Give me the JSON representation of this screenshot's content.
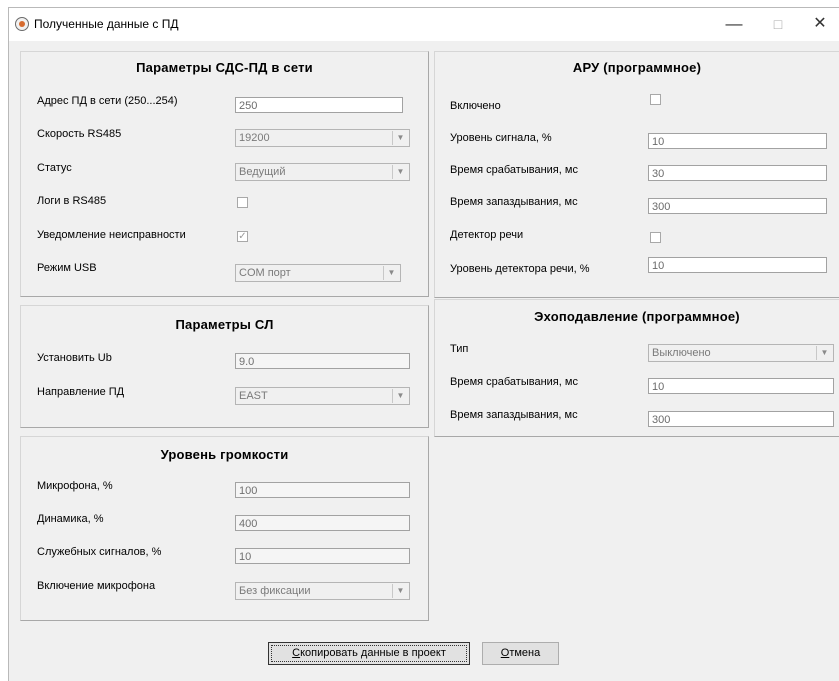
{
  "window": {
    "title": "Полученные данные с ПД",
    "minimize": "—",
    "maximize": "□",
    "close": "✕"
  },
  "network_group": {
    "title": "Параметры СДС-ПД в сети",
    "address_label": "Адрес  ПД в сети (250...254)",
    "address_value": "250",
    "speed_label": "Скорость RS485",
    "speed_value": "19200",
    "status_label": "Статус",
    "status_value": "Ведущий",
    "logs_label": "Логи в RS485",
    "logs_checked": false,
    "fault_label": "Уведомление неисправности",
    "fault_checked": true,
    "usb_label": "Режим USB",
    "usb_value": "COM порт"
  },
  "line_group": {
    "title": "Параметры СЛ",
    "ub_label": "Установить Ub",
    "ub_value": "9.0",
    "direction_label": "Направление ПД",
    "direction_value": "EAST"
  },
  "volume_group": {
    "title": "Уровень громкости",
    "mic_label": "Микрофона, %",
    "mic_value": "100",
    "speaker_label": "Динамика, %",
    "speaker_value": "400",
    "service_label": "Служебных сигналов, %",
    "service_value": "10",
    "mic_mode_label": "Включение микрофона",
    "mic_mode_value": "Без фиксации"
  },
  "agc_group": {
    "title": "АРУ (программное)",
    "enabled_label": "Включено",
    "enabled_checked": false,
    "level_label": "Уровень сигнала, %",
    "level_value": "10",
    "attack_label": "Время срабатывания, мс",
    "attack_value": "30",
    "release_label": "Время запаздывания, мс",
    "release_value": "300",
    "voice_label": "Детектор речи",
    "voice_checked": false,
    "voice_level_label": "Уровень детектора речи, %",
    "voice_level_value": "10"
  },
  "echo_group": {
    "title": "Эхоподавление (программное)",
    "type_label": "Тип",
    "type_value": "Выключено",
    "attack_label": "Время срабатывания, мс",
    "attack_value": "10",
    "release_label": "Время запаздывания, мс",
    "release_value": "300"
  },
  "buttons": {
    "copy_hotkey": "С",
    "copy_rest": "копировать данные в проект",
    "cancel_hotkey": "О",
    "cancel_rest": "тмена"
  },
  "icons": {
    "arrow": "▼",
    "check": "✓"
  }
}
